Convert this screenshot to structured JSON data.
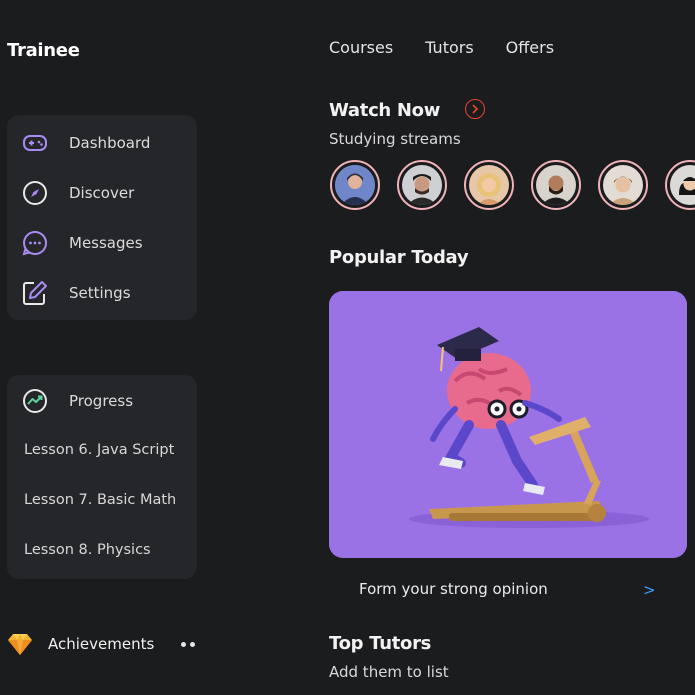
{
  "app": {
    "brand": "Trainee"
  },
  "sidebar": {
    "nav": [
      {
        "label": "Dashboard",
        "icon": "gamepad-icon"
      },
      {
        "label": "Discover",
        "icon": "compass-icon"
      },
      {
        "label": "Messages",
        "icon": "chat-bubble-icon"
      },
      {
        "label": "Settings",
        "icon": "edit-icon"
      }
    ],
    "progress": {
      "label": "Progress",
      "icon": "trend-up-icon",
      "lessons": [
        "Lesson 6. Java Script",
        "Lesson 7. Basic Math",
        "Lesson 8. Physics"
      ]
    },
    "achievements": {
      "label": "Achievements",
      "icon": "diamond-icon"
    }
  },
  "top_nav": [
    "Courses",
    "Tutors",
    "Offers"
  ],
  "watch_now": {
    "title": "Watch Now",
    "subtitle": "Studying streams",
    "avatars": [
      "avatar-1",
      "avatar-2",
      "avatar-3",
      "avatar-4",
      "avatar-5",
      "avatar-6"
    ]
  },
  "popular": {
    "title": "Popular Today",
    "caption": "Form your strong opinion",
    "image": "brain-on-treadmill-illustration"
  },
  "top_tutors": {
    "title": "Top Tutors",
    "subtitle": "Add them to list"
  },
  "colors": {
    "background": "#1b1c1e",
    "panel": "#252629",
    "accent_purple": "#9a72e6",
    "accent_red": "#e8452d",
    "link_blue": "#3aa0ff",
    "avatar_ring": "#f0b3b8"
  }
}
